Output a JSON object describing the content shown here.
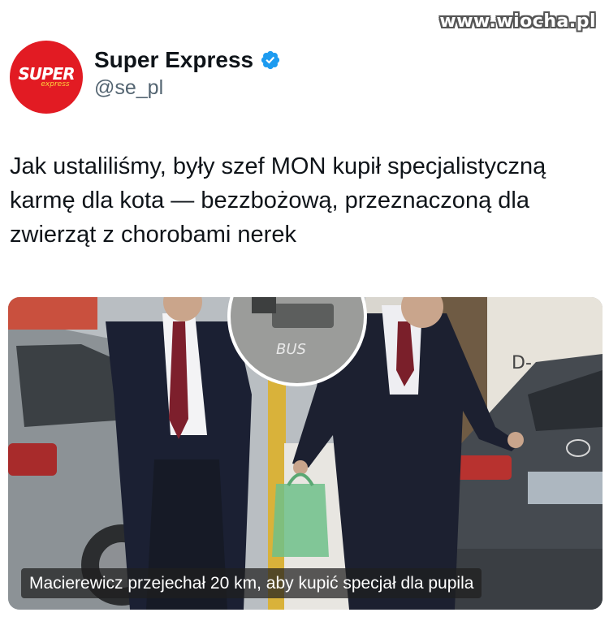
{
  "watermark": "www.wiocha.pl",
  "account": {
    "display_name": "Super Express",
    "handle": "@se_pl",
    "avatar_logo_main": "SUPER",
    "avatar_logo_sub": "express",
    "verified": true
  },
  "tweet": {
    "text": "Jak ustaliliśmy, były szef MON kupił specjalistyczną karmę dla kota — bezzbożową, przeznaczoną dla zwierząt z chorobami nerek"
  },
  "media": {
    "caption": "Macierewicz przejechał 20 km, aby kupić specjał dla pupila",
    "inset_road_text": "BUS",
    "shop_sign_text": "D-"
  },
  "colors": {
    "brand_red": "#e21b23",
    "verified_blue": "#1d9bf0",
    "text_primary": "#0f1419",
    "text_secondary": "#536471"
  }
}
